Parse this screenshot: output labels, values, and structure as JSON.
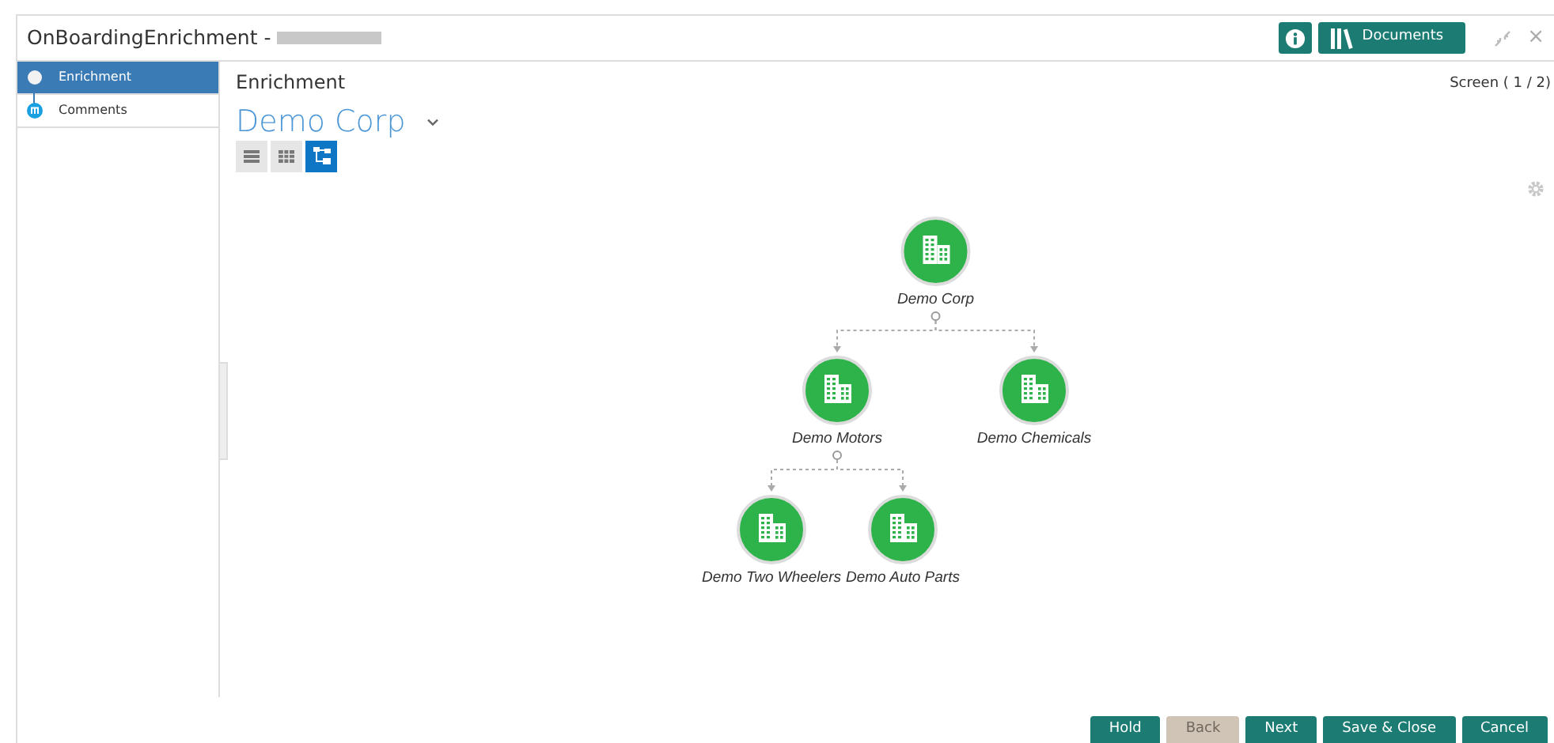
{
  "window": {
    "title": "OnBoardingEnrichment -",
    "redacted": true,
    "header_buttons": [
      {
        "kind": "info"
      },
      {
        "kind": "documents",
        "label": "Documents"
      }
    ],
    "close": "×"
  },
  "sidebar": {
    "items": [
      {
        "label": "Enrichment",
        "selected": true
      },
      {
        "label": "Comments",
        "selected": false
      }
    ]
  },
  "main": {
    "title": "Enrichment",
    "screen": "Screen ( 1 / 2)",
    "entity": "Demo Corp",
    "view_toggles": [
      {
        "kind": "list",
        "selected": false
      },
      {
        "kind": "grid",
        "selected": false
      },
      {
        "kind": "tree",
        "selected": true
      }
    ],
    "tree": [
      {
        "label": "Demo Corp",
        "children": [
          {
            "label": "Demo Motors",
            "children": [
              {
                "label": "Demo Two Wheelers"
              },
              {
                "label": "Demo Auto Parts"
              }
            ]
          },
          {
            "label": "Demo Chemicals"
          }
        ]
      }
    ]
  },
  "footer_buttons": [
    {
      "label": "Hold",
      "disabled": false
    },
    {
      "label": "Back",
      "disabled": true
    },
    {
      "label": "Next",
      "disabled": false
    },
    {
      "label": "Save & Close",
      "disabled": false
    },
    {
      "label": "Cancel",
      "disabled": false
    }
  ]
}
